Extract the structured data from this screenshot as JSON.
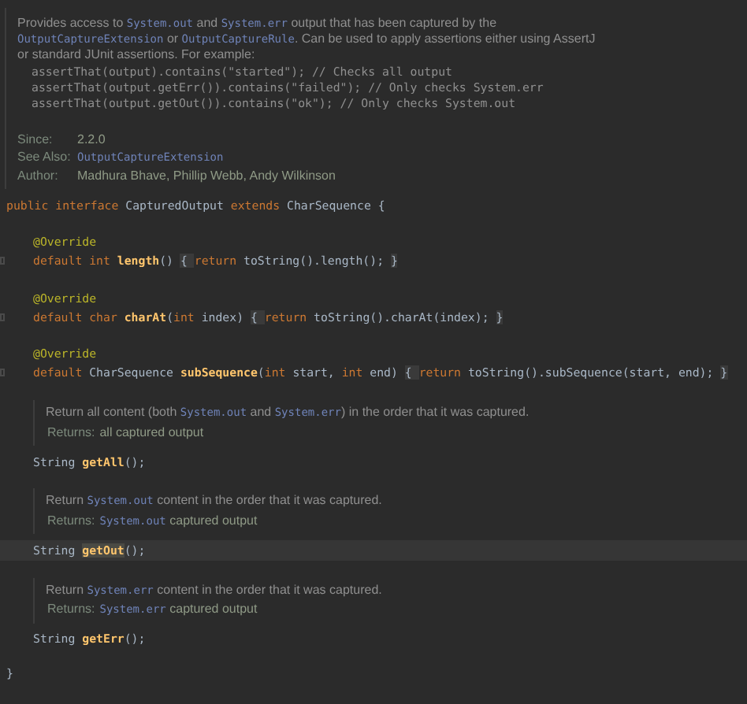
{
  "class_doc": {
    "paragraph": [
      {
        "kind": "text",
        "t": "Provides access to "
      },
      {
        "kind": "link",
        "t": "System.out"
      },
      {
        "kind": "text",
        "t": " and "
      },
      {
        "kind": "link",
        "t": "System.err"
      },
      {
        "kind": "text",
        "t": " output that has been captured by the "
      },
      {
        "kind": "link",
        "t": "OutputCaptureExtension"
      },
      {
        "kind": "text",
        "t": " or "
      },
      {
        "kind": "link",
        "t": "OutputCaptureRule"
      },
      {
        "kind": "text",
        "t": ". Can be used to apply assertions either using AssertJ or standard JUnit assertions. For example:"
      }
    ],
    "examples": [
      "assertThat(output).contains(\"started\"); // Checks all output",
      "assertThat(output.getErr()).contains(\"failed\"); // Only checks System.err",
      "assertThat(output.getOut()).contains(\"ok\"); // Only checks System.out"
    ],
    "tags": [
      {
        "label": "Since:",
        "value": [
          {
            "kind": "text",
            "t": "2.2.0"
          }
        ]
      },
      {
        "label": "See Also:",
        "value": [
          {
            "kind": "link",
            "t": "OutputCaptureExtension"
          }
        ]
      },
      {
        "label": "Author:",
        "value": [
          {
            "kind": "text",
            "t": "Madhura Bhave, Phillip Webb, Andy Wilkinson"
          }
        ]
      }
    ]
  },
  "declaration": {
    "tokens": [
      {
        "kind": "keyword",
        "t": "public interface "
      },
      {
        "kind": "plain",
        "t": "CapturedOutput "
      },
      {
        "kind": "keyword",
        "t": "extends "
      },
      {
        "kind": "plain",
        "t": "CharSequence {"
      }
    ]
  },
  "members": [
    {
      "annotation": "@Override",
      "signature": {
        "current": false,
        "foldable": true,
        "tokens": [
          {
            "kind": "keyword",
            "t": "default int "
          },
          {
            "kind": "method",
            "t": "length"
          },
          {
            "kind": "plain",
            "t": "() "
          },
          {
            "kind": "fold",
            "t": "{ "
          },
          {
            "kind": "keyword",
            "t": "return "
          },
          {
            "kind": "plain",
            "t": "toString().length(); "
          },
          {
            "kind": "fold",
            "t": "}"
          }
        ]
      }
    },
    {
      "annotation": "@Override",
      "signature": {
        "current": false,
        "foldable": true,
        "tokens": [
          {
            "kind": "keyword",
            "t": "default char "
          },
          {
            "kind": "method",
            "t": "charAt"
          },
          {
            "kind": "plain",
            "t": "("
          },
          {
            "kind": "keyword",
            "t": "int "
          },
          {
            "kind": "plain",
            "t": "index) "
          },
          {
            "kind": "fold",
            "t": "{ "
          },
          {
            "kind": "keyword",
            "t": "return "
          },
          {
            "kind": "plain",
            "t": "toString().charAt(index); "
          },
          {
            "kind": "fold",
            "t": "}"
          }
        ]
      }
    },
    {
      "annotation": "@Override",
      "signature": {
        "current": false,
        "foldable": true,
        "tokens": [
          {
            "kind": "keyword",
            "t": "default "
          },
          {
            "kind": "plain",
            "t": "CharSequence "
          },
          {
            "kind": "method",
            "t": "subSequence"
          },
          {
            "kind": "plain",
            "t": "("
          },
          {
            "kind": "keyword",
            "t": "int "
          },
          {
            "kind": "plain",
            "t": "start, "
          },
          {
            "kind": "keyword",
            "t": "int "
          },
          {
            "kind": "plain",
            "t": "end) "
          },
          {
            "kind": "fold",
            "t": "{ "
          },
          {
            "kind": "keyword",
            "t": "return "
          },
          {
            "kind": "plain",
            "t": "toString().subSequence(start, end); "
          },
          {
            "kind": "fold",
            "t": "}"
          }
        ]
      }
    },
    {
      "doc": {
        "summary": [
          {
            "kind": "text",
            "t": "Return all content (both "
          },
          {
            "kind": "link",
            "t": "System.out"
          },
          {
            "kind": "text",
            "t": " and "
          },
          {
            "kind": "link",
            "t": "System.err"
          },
          {
            "kind": "text",
            "t": ") in the order that it was captured."
          }
        ],
        "returns_label": "Returns:",
        "returns": [
          {
            "kind": "text",
            "t": "all captured output"
          }
        ]
      },
      "signature": {
        "current": false,
        "foldable": false,
        "tokens": [
          {
            "kind": "plain",
            "t": "String "
          },
          {
            "kind": "method",
            "t": "getAll"
          },
          {
            "kind": "plain",
            "t": "();"
          }
        ]
      }
    },
    {
      "doc": {
        "summary": [
          {
            "kind": "text",
            "t": "Return "
          },
          {
            "kind": "link",
            "t": "System.out"
          },
          {
            "kind": "text",
            "t": " content in the order that it was captured."
          }
        ],
        "returns_label": "Returns:",
        "returns": [
          {
            "kind": "link",
            "t": "System.out"
          },
          {
            "kind": "text",
            "t": " captured output"
          }
        ]
      },
      "signature": {
        "current": true,
        "foldable": false,
        "tokens": [
          {
            "kind": "plain",
            "t": "String "
          },
          {
            "kind": "method",
            "t": "getOut"
          },
          {
            "kind": "plain",
            "t": "();"
          }
        ]
      }
    },
    {
      "doc": {
        "summary": [
          {
            "kind": "text",
            "t": "Return "
          },
          {
            "kind": "link",
            "t": "System.err"
          },
          {
            "kind": "text",
            "t": " content in the order that it was captured."
          }
        ],
        "returns_label": "Returns:",
        "returns": [
          {
            "kind": "link",
            "t": "System.err"
          },
          {
            "kind": "text",
            "t": " captured output"
          }
        ]
      },
      "signature": {
        "current": false,
        "foldable": false,
        "tokens": [
          {
            "kind": "plain",
            "t": "String "
          },
          {
            "kind": "method",
            "t": "getErr"
          },
          {
            "kind": "plain",
            "t": "();"
          }
        ]
      }
    }
  ],
  "closing": "}"
}
